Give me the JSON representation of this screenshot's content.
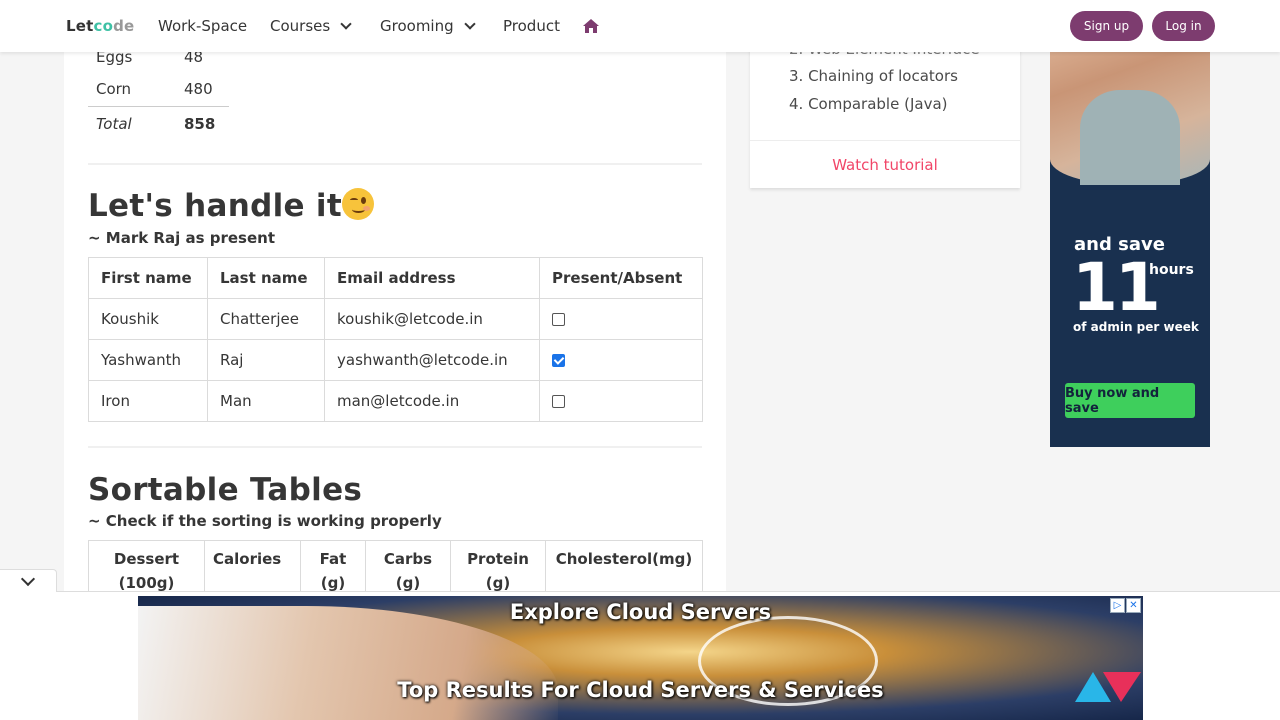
{
  "navbar": {
    "logo": {
      "part1": "Let",
      "part2": "c",
      "part3": "o",
      "part4": "de"
    },
    "items": [
      {
        "label": "Work-Space"
      },
      {
        "label": "Courses"
      },
      {
        "label": "Grooming"
      },
      {
        "label": "Product"
      }
    ],
    "signup_label": "Sign up",
    "login_label": "Log in",
    "accent_color": "#7d3c6f"
  },
  "food_table": {
    "rows": [
      {
        "name": "Eggs",
        "value": "48"
      },
      {
        "name": "Corn",
        "value": "480"
      }
    ],
    "total_label": "Total",
    "total_value": "858"
  },
  "attendance": {
    "title": "Let's handle it",
    "subtitle": "~ Mark Raj as present",
    "headers": [
      "First name",
      "Last name",
      "Email address",
      "Present/Absent"
    ],
    "rows": [
      {
        "first": "Koushik",
        "last": "Chatterjee",
        "email": "koushik@letcode.in",
        "present": false
      },
      {
        "first": "Yashwanth",
        "last": "Raj",
        "email": "yashwanth@letcode.in",
        "present": true
      },
      {
        "first": "Iron",
        "last": "Man",
        "email": "man@letcode.in",
        "present": false
      }
    ]
  },
  "sortable": {
    "title": "Sortable Tables",
    "subtitle": "~ Check if the sorting is working properly",
    "headers": [
      {
        "line1": "Dessert",
        "line2": "(100g)"
      },
      {
        "line1": "Calories",
        "line2": ""
      },
      {
        "line1": "Fat",
        "line2": "(g)"
      },
      {
        "line1": "Carbs",
        "line2": "(g)"
      },
      {
        "line1": "Protein",
        "line2": "(g)"
      },
      {
        "line1": "Cholesterol(mg)",
        "line2": ""
      }
    ]
  },
  "side_card": {
    "partial_item": "2. Web Element Interface",
    "items": [
      "3. Chaining of locators",
      "4. Comparable (Java)"
    ],
    "footer_link": "Watch tutorial"
  },
  "ad_right": {
    "save": "and save",
    "number": "11",
    "hours": "hours",
    "admin": "of admin per week",
    "button": "Buy now and save"
  },
  "bottom_ad": {
    "line1": "Explore Cloud Servers",
    "line2": "Top Results For Cloud Servers & Services"
  }
}
